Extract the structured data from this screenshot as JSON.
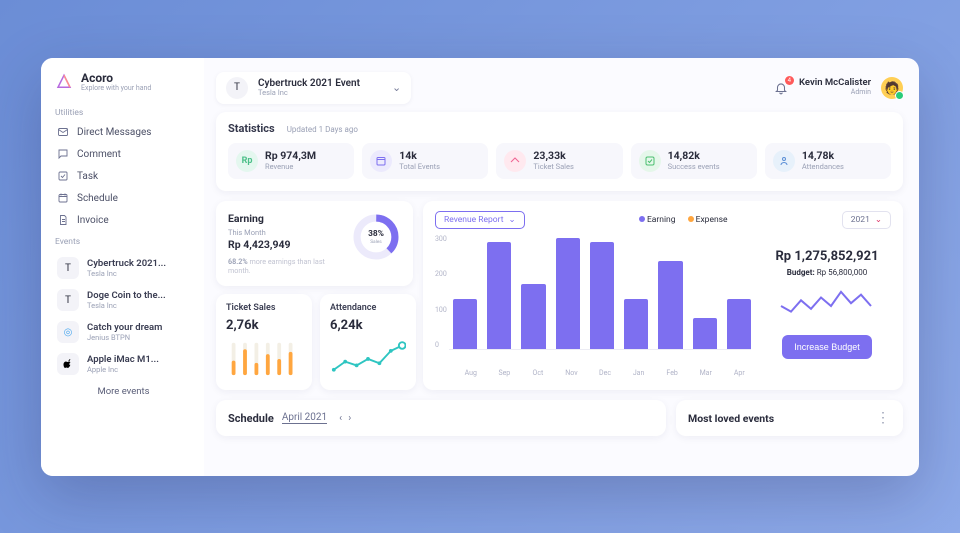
{
  "brand": {
    "name": "Acoro",
    "tagline": "Explore with your hand"
  },
  "sidebar": {
    "utilities_label": "Utilities",
    "events_label": "Events",
    "nav": [
      {
        "label": "Direct Messages",
        "icon": "mail-icon"
      },
      {
        "label": "Comment",
        "icon": "comment-icon"
      },
      {
        "label": "Task",
        "icon": "task-icon"
      },
      {
        "label": "Schedule",
        "icon": "schedule-icon"
      },
      {
        "label": "Invoice",
        "icon": "invoice-icon"
      }
    ],
    "events": [
      {
        "title": "Cybertruck 2021...",
        "subtitle": "Tesla Inc",
        "glyph": "T",
        "icon": "tesla-icon"
      },
      {
        "title": "Doge Coin to the...",
        "subtitle": "Tesla Inc",
        "glyph": "T",
        "icon": "tesla-icon"
      },
      {
        "title": "Catch your dream",
        "subtitle": "Jenius BTPN",
        "glyph": "◎",
        "icon": "jenius-icon",
        "color": "#4aa7ee"
      },
      {
        "title": "Apple iMac M1...",
        "subtitle": "Apple Inc",
        "glyph": "",
        "icon": "apple-icon"
      }
    ],
    "more_label": "More events"
  },
  "header": {
    "event_title": "Cybertruck 2021 Event",
    "event_sub": "Tesla Inc",
    "notif_count": "4",
    "user_name": "Kevin McCalister",
    "user_role": "Admin"
  },
  "stats": {
    "title": "Statistics",
    "updated": "Updated 1 Days ago",
    "items": [
      {
        "value": "Rp 974,3M",
        "label": "Revenue",
        "kind": "rev",
        "glyph": "Rp"
      },
      {
        "value": "14k",
        "label": "Total Events",
        "kind": "evt"
      },
      {
        "value": "23,33k",
        "label": "Ticket Sales",
        "kind": "tkt"
      },
      {
        "value": "14,82k",
        "label": "Success events",
        "kind": "suc"
      },
      {
        "value": "14,78k",
        "label": "Attendances",
        "kind": "att"
      }
    ]
  },
  "earning": {
    "title": "Earning",
    "subtitle": "This Month",
    "amount": "Rp 4,423,949",
    "pct_label": "68.2%",
    "note_rest": " more earnings than last month.",
    "donut_pct": "38%",
    "donut_sub": "Sales"
  },
  "ticket_sales": {
    "title": "Ticket Sales",
    "value": "2,76k"
  },
  "attendance": {
    "title": "Attendance",
    "value": "6,24k"
  },
  "report": {
    "selector_label": "Revenue Report",
    "legend_earning": "Earning",
    "legend_expense": "Expense",
    "year_label": "2021",
    "amount": "Rp 1,275,852,921",
    "budget_label": "Budget: ",
    "budget_value": "Rp 56,800,000",
    "button": "Increase Budget"
  },
  "chart_data": {
    "report_bars": {
      "type": "bar",
      "categories": [
        "Aug",
        "Sep",
        "Oct",
        "Nov",
        "Dec",
        "Jan",
        "Feb",
        "Mar",
        "Apr"
      ],
      "values": [
        130,
        280,
        170,
        290,
        280,
        130,
        230,
        80,
        130
      ],
      "ylim": [
        0,
        300
      ],
      "y_ticks": [
        "300",
        "200",
        "100",
        "0"
      ]
    },
    "earning_donut": {
      "type": "pie",
      "value": 38,
      "max": 100
    },
    "ticket_sales_bars": {
      "type": "bar",
      "values": [
        45,
        80,
        38,
        65,
        50,
        72
      ]
    },
    "attendance_line": {
      "type": "line",
      "values": [
        10,
        25,
        18,
        30,
        22,
        45,
        55
      ]
    },
    "budget_spark": {
      "type": "line",
      "values": [
        30,
        20,
        40,
        25,
        45,
        30,
        55,
        35,
        50,
        30
      ]
    }
  },
  "schedule": {
    "title": "Schedule",
    "month": "April 2021"
  },
  "loved": {
    "title": "Most loved events"
  },
  "colors": {
    "primary": "#7d6ff0",
    "orange": "#ffa63f",
    "teal": "#2ec5c1",
    "red": "#ff5a5a"
  }
}
